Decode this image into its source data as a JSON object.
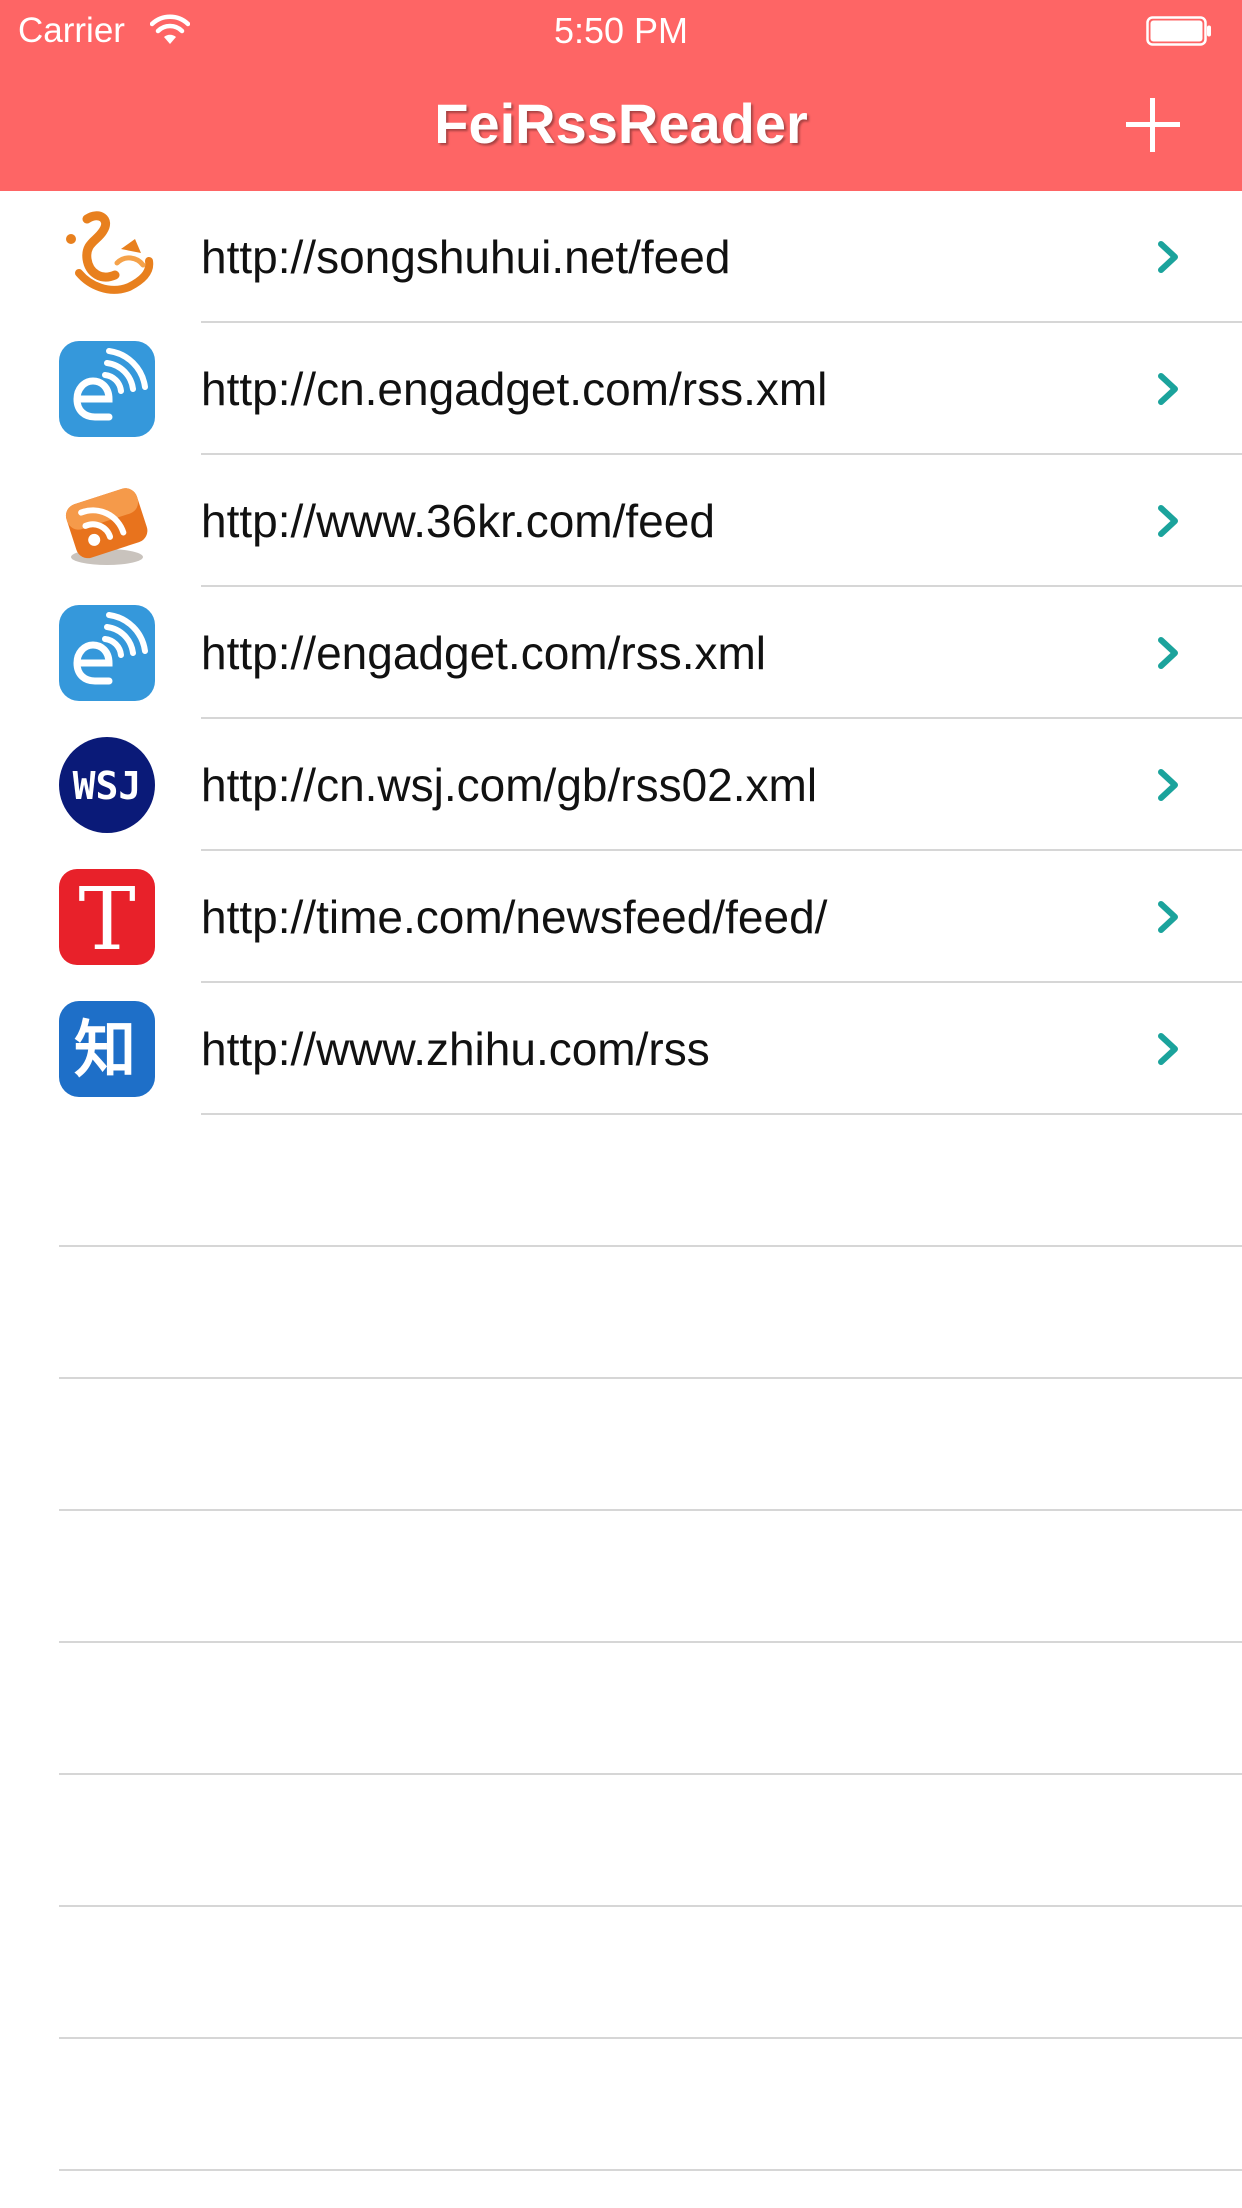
{
  "status_bar": {
    "carrier": "Carrier",
    "time": "5:50 PM"
  },
  "nav": {
    "title": "FeiRssReader",
    "add_icon": "plus-icon"
  },
  "colors": {
    "header": "#FE6565",
    "accent": "#1BA39C",
    "separator": "#D6D6D6"
  },
  "feeds": [
    {
      "url": "http://songshuhui.net/feed",
      "icon": "songshuhui-icon"
    },
    {
      "url": "http://cn.engadget.com/rss.xml",
      "icon": "engadget-icon"
    },
    {
      "url": "http://www.36kr.com/feed",
      "icon": "rss-icon"
    },
    {
      "url": "http://engadget.com/rss.xml",
      "icon": "engadget-icon"
    },
    {
      "url": "http://cn.wsj.com/gb/rss02.xml",
      "icon": "wsj-icon"
    },
    {
      "url": "http://time.com/newsfeed/feed/",
      "icon": "time-icon"
    },
    {
      "url": "http://www.zhihu.com/rss",
      "icon": "zhihu-icon"
    }
  ],
  "icon_text": {
    "wsj": "WSJ",
    "time": "T",
    "zhihu": "知"
  }
}
